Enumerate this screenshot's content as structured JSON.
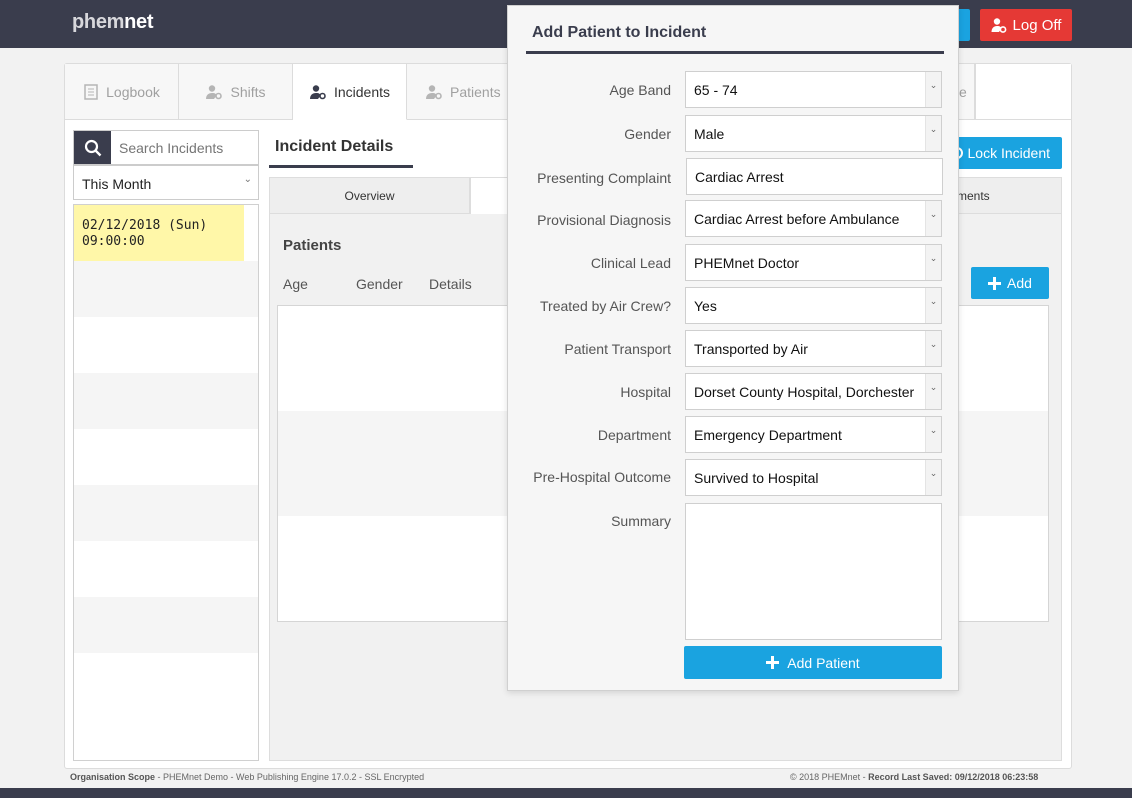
{
  "app": {
    "logo_light": "phem",
    "logo_bold": "net"
  },
  "topbar": {
    "logoff_label": "Log Off"
  },
  "tabs": [
    {
      "label": "Logbook",
      "icon": "book-icon"
    },
    {
      "label": "Shifts",
      "icon": "user-gear-icon"
    },
    {
      "label": "Incidents",
      "icon": "user-gear-icon"
    },
    {
      "label": "Patients",
      "icon": "user-gear-icon"
    },
    {
      "label": "e"
    }
  ],
  "sidebar": {
    "search_placeholder": "Search Incidents",
    "period": "This Month",
    "selected_incident": {
      "date": "02/12/2018 (Sun)",
      "time": "09:00:00"
    }
  },
  "details": {
    "title": "Incident Details",
    "lock_label": "Lock Incident",
    "subtabs": [
      "Overview",
      "ments"
    ],
    "patients_label": "Patients",
    "columns": [
      "Age",
      "Gender",
      "Details"
    ],
    "add_label": "Add"
  },
  "footer": {
    "left_bold": "Organisation Scope",
    "left_rest": " - PHEMnet Demo - Web Publishing Engine 17.0.2 - SSL Encrypted",
    "right_rest": "© 2018 PHEMnet - ",
    "right_bold": "Record Last Saved: 09/12/2018 06:23:58"
  },
  "modal": {
    "title": "Add Patient to Incident",
    "fields": {
      "age_band": {
        "label": "Age Band",
        "value": "65 - 74"
      },
      "gender": {
        "label": "Gender",
        "value": "Male"
      },
      "presenting_complaint": {
        "label": "Presenting Complaint",
        "value": "Cardiac Arrest"
      },
      "provisional_diagnosis": {
        "label": "Provisional Diagnosis",
        "value": "Cardiac Arrest before Ambulance"
      },
      "clinical_lead": {
        "label": "Clinical Lead",
        "value": "PHEMnet Doctor"
      },
      "treated_by_air_crew": {
        "label": "Treated by Air Crew?",
        "value": "Yes"
      },
      "patient_transport": {
        "label": "Patient Transport",
        "value": "Transported by Air"
      },
      "hospital": {
        "label": "Hospital",
        "value": "Dorset County Hospital, Dorchester"
      },
      "department": {
        "label": "Department",
        "value": "Emergency Department"
      },
      "pre_hospital_outcome": {
        "label": "Pre-Hospital Outcome",
        "value": "Survived to Hospital"
      },
      "summary": {
        "label": "Summary",
        "value": ""
      }
    },
    "submit_label": "Add Patient"
  },
  "colors": {
    "navy": "#3a3d4d",
    "blue": "#1aa3e0",
    "red": "#e53935",
    "highlight": "#fff7a8"
  }
}
